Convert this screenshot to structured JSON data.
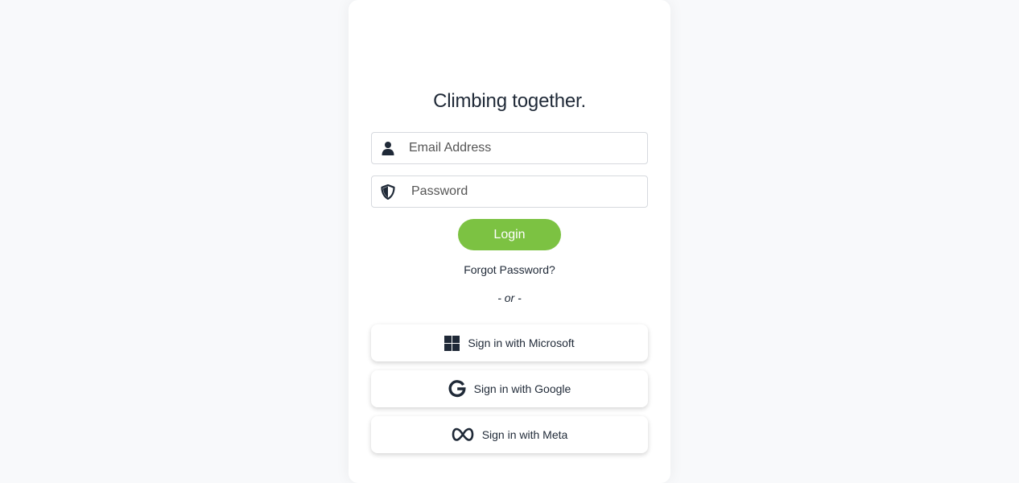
{
  "login": {
    "title": "Climbing together.",
    "email": {
      "placeholder": "Email Address",
      "icon": "user-icon"
    },
    "password": {
      "placeholder": "Password",
      "icon": "shield-icon"
    },
    "login_label": "Login",
    "forgot_label": "Forgot Password?",
    "divider": "- or -",
    "sso": [
      {
        "label": "Sign in with Microsoft",
        "icon": "microsoft-icon"
      },
      {
        "label": "Sign in with Google",
        "icon": "google-icon"
      },
      {
        "label": "Sign in with Meta",
        "icon": "meta-icon"
      }
    ]
  },
  "colors": {
    "accent": "#7cc242",
    "background": "#f8f9fb",
    "text": "#1f2937"
  }
}
